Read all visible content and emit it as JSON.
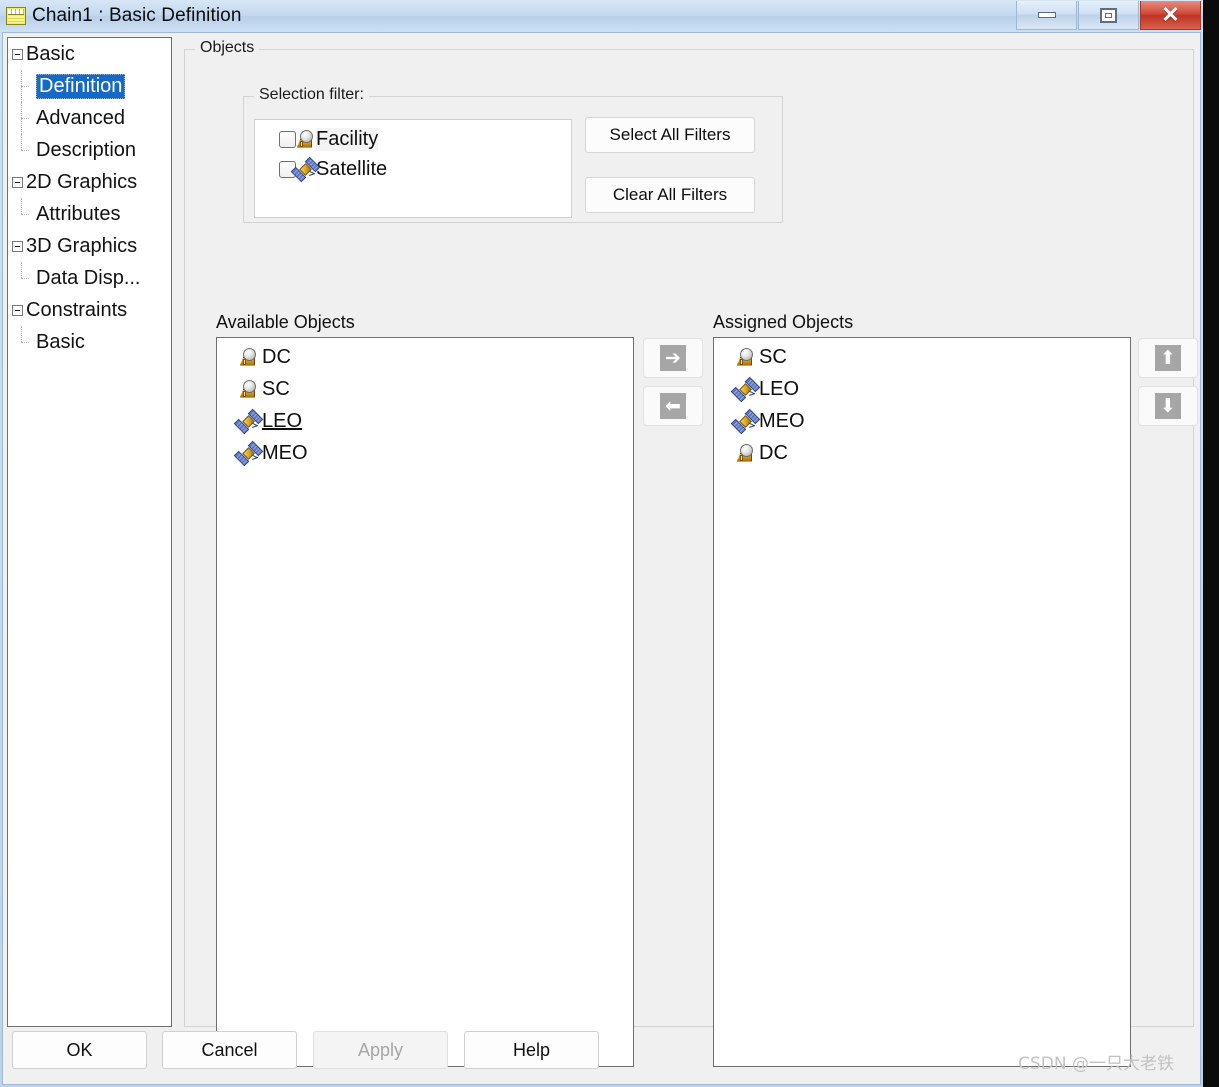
{
  "window": {
    "title": "Chain1 : Basic Definition",
    "icon": "chain-document-icon",
    "controls": {
      "minimize": "minimize-icon",
      "maximize": "maximize-icon",
      "close": "close-icon",
      "close_glyph": "✕"
    }
  },
  "tree": {
    "nodes": [
      {
        "label": "Basic",
        "level": 0,
        "expander": true,
        "selected": false
      },
      {
        "label": "Definition",
        "level": 1,
        "expander": false,
        "selected": true
      },
      {
        "label": "Advanced",
        "level": 1,
        "expander": false,
        "selected": false
      },
      {
        "label": "Description",
        "level": 1,
        "expander": false,
        "selected": false
      },
      {
        "label": "2D Graphics",
        "level": 0,
        "expander": true,
        "selected": false
      },
      {
        "label": "Attributes",
        "level": 1,
        "expander": false,
        "selected": false
      },
      {
        "label": "3D Graphics",
        "level": 0,
        "expander": true,
        "selected": false
      },
      {
        "label": "Data Disp...",
        "level": 1,
        "expander": false,
        "selected": false
      },
      {
        "label": "Constraints",
        "level": 0,
        "expander": true,
        "selected": false
      },
      {
        "label": "Basic",
        "level": 1,
        "expander": false,
        "selected": false
      }
    ]
  },
  "objects_group": {
    "title": "Objects",
    "selection_filter": {
      "title": "Selection filter:",
      "items": [
        {
          "label": "Facility",
          "icon": "facility-icon",
          "checked": false
        },
        {
          "label": "Satellite",
          "icon": "satellite-icon",
          "checked": false
        }
      ],
      "select_all_label": "Select All Filters",
      "clear_all_label": "Clear All Filters"
    },
    "available": {
      "caption": "Available Objects",
      "items": [
        {
          "label": "DC",
          "icon": "facility-icon",
          "focused": false
        },
        {
          "label": "SC",
          "icon": "facility-icon",
          "focused": false
        },
        {
          "label": "LEO",
          "icon": "satellite-icon",
          "focused": true
        },
        {
          "label": "MEO",
          "icon": "satellite-icon",
          "focused": false
        }
      ]
    },
    "assigned": {
      "caption": "Assigned Objects",
      "items": [
        {
          "label": "SC",
          "icon": "facility-icon",
          "focused": false
        },
        {
          "label": "LEO",
          "icon": "satellite-icon",
          "focused": false
        },
        {
          "label": "MEO",
          "icon": "satellite-icon",
          "focused": false
        },
        {
          "label": "DC",
          "icon": "facility-icon",
          "focused": false
        }
      ]
    },
    "transfer_buttons": {
      "add": {
        "icon": "arrow-right-icon",
        "glyph": "➔",
        "enabled": false
      },
      "remove": {
        "icon": "arrow-left-icon",
        "glyph": "⬅",
        "enabled": false
      }
    },
    "reorder_buttons": {
      "move_up": {
        "icon": "arrow-up-icon",
        "glyph": "⬆",
        "enabled": false
      },
      "move_down": {
        "icon": "arrow-down-icon",
        "glyph": "⬇",
        "enabled": false
      }
    }
  },
  "dialog_buttons": [
    {
      "label": "OK",
      "enabled": true
    },
    {
      "label": "Cancel",
      "enabled": true
    },
    {
      "label": "Apply",
      "enabled": false
    },
    {
      "label": "Help",
      "enabled": true
    }
  ],
  "watermark": "CSDN @一只大老铁",
  "colors": {
    "selection_blue": "#1669c6",
    "titlebar_blue": "#c4d8ee",
    "close_red": "#d0493a",
    "disabled_grey": "#a6a6a6"
  }
}
